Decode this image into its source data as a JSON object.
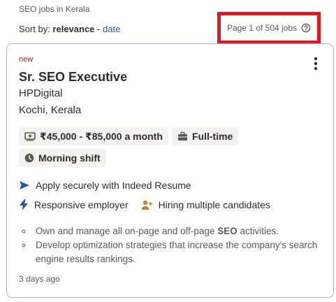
{
  "breadcrumb": "SEO jobs in Kerala",
  "sort": {
    "label": "Sort by:",
    "current": "relevance",
    "separator": "-",
    "alternative": "date"
  },
  "pagination": {
    "text": "Page 1 of 504 jobs",
    "highlight_color": "#e8161e"
  },
  "job": {
    "badge": "new",
    "title": "Sr. SEO Executive",
    "company": "HPDigital",
    "location": "Kochi, Kerala",
    "tags": [
      {
        "icon": "money-icon",
        "label": "₹45,000 - ₹85,000 a month"
      },
      {
        "icon": "briefcase-icon",
        "label": "Full-time"
      },
      {
        "icon": "clock-icon",
        "label": "Morning shift"
      }
    ],
    "apply_text": "Apply securely with Indeed Resume",
    "responsive_text": "Responsive employer",
    "hiring_text": "Hiring multiple candidates",
    "snippet": {
      "item1_pre": "Own and manage all on-page and off-page ",
      "item1_bold": "SEO",
      "item1_post": " activities.",
      "item2": "Develop optimization strategies that increase the company's search engine results rankings."
    },
    "posted": "3 days ago"
  },
  "colors": {
    "accent_blue": "#2557a7",
    "new_badge": "#a9252b",
    "card_border": "#a6b4d6",
    "hiring_icon": "#c9822a"
  }
}
